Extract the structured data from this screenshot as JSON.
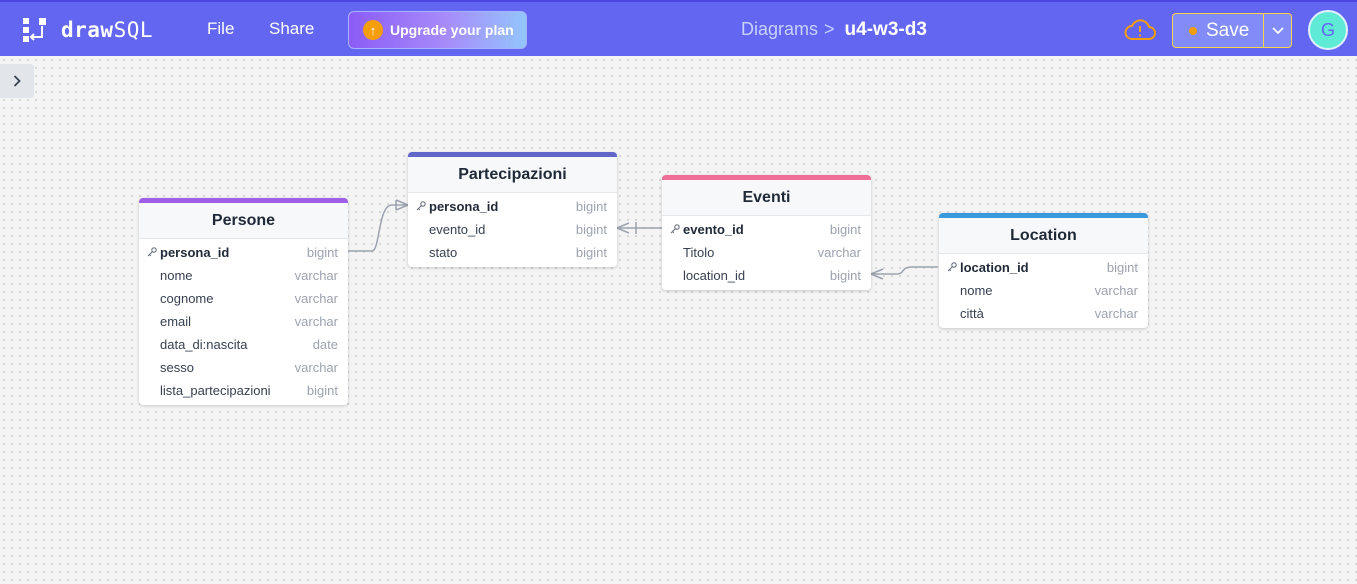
{
  "app": {
    "logo_bold": "draw",
    "logo_light": "SQL",
    "menu": {
      "file": "File",
      "share": "Share"
    },
    "upgrade_label": "Upgrade your plan",
    "breadcrumb": {
      "parent": "Diagrams",
      "separator": ">",
      "current": "u4-w3-d3"
    },
    "save_label": "Save",
    "avatar_initial": "G",
    "colors": {
      "topbar": "#6366f1",
      "save_status_dot": "#f59e0b",
      "avatar": "#5eead4"
    },
    "icons": {
      "logo": "drawsql-logo-icon",
      "upgrade": "arrow-up-circle-icon",
      "cloud": "cloud-alert-icon",
      "dropdown": "chevron-down-icon",
      "sidebar": "chevron-right-icon",
      "primary_key": "key-icon"
    }
  },
  "tables": {
    "persone": {
      "name": "Persone",
      "color": "#9f5ee6",
      "columns": [
        {
          "name": "persona_id",
          "type": "bigint",
          "pk": true
        },
        {
          "name": "nome",
          "type": "varchar"
        },
        {
          "name": "cognome",
          "type": "varchar"
        },
        {
          "name": "email",
          "type": "varchar"
        },
        {
          "name": "data_di:nascita",
          "type": "date"
        },
        {
          "name": "sesso",
          "type": "varchar"
        },
        {
          "name": "lista_partecipazioni",
          "type": "bigint"
        }
      ]
    },
    "partecipazioni": {
      "name": "Partecipazioni",
      "color": "#6167c9",
      "columns": [
        {
          "name": "persona_id",
          "type": "bigint",
          "pk": true
        },
        {
          "name": "evento_id",
          "type": "bigint"
        },
        {
          "name": "stato",
          "type": "bigint"
        }
      ]
    },
    "eventi": {
      "name": "Eventi",
      "color": "#ee6e98",
      "columns": [
        {
          "name": "evento_id",
          "type": "bigint",
          "pk": true
        },
        {
          "name": "Titolo",
          "type": "varchar"
        },
        {
          "name": "location_id",
          "type": "bigint"
        }
      ]
    },
    "location": {
      "name": "Location",
      "color": "#3a98dc",
      "columns": [
        {
          "name": "location_id",
          "type": "bigint",
          "pk": true
        },
        {
          "name": "nome",
          "type": "varchar"
        },
        {
          "name": "città",
          "type": "varchar"
        }
      ]
    }
  }
}
